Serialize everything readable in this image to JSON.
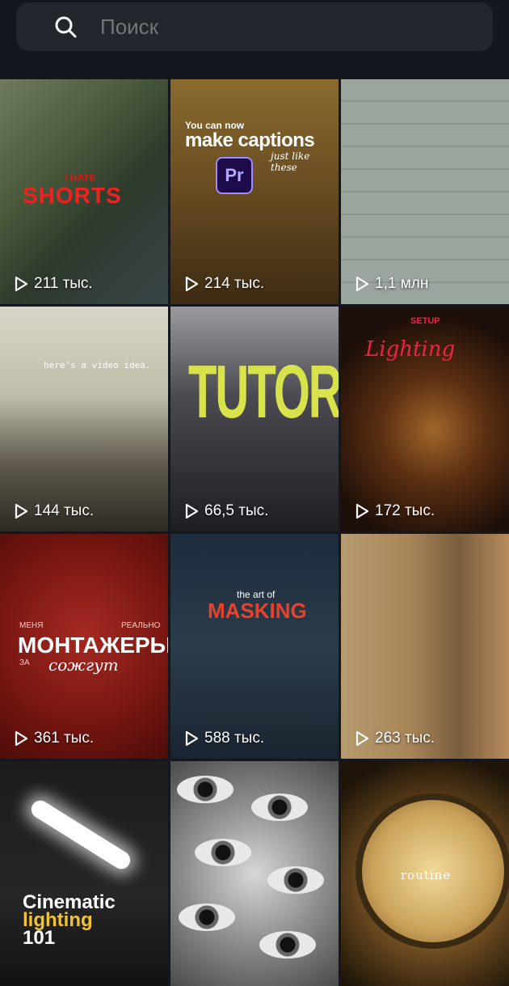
{
  "search": {
    "placeholder": "Поиск"
  },
  "grid": {
    "tiles": [
      {
        "views": "211 тыс.",
        "caption_a": "I HATE",
        "caption_b": "SHORTS"
      },
      {
        "views": "214 тыс.",
        "caption_a": "You can now",
        "caption_b": "make captions",
        "caption_c": "just like these",
        "badge": "Pr"
      },
      {
        "views": "1,1 млн"
      },
      {
        "views": "144 тыс.",
        "caption_a": "here's a video idea."
      },
      {
        "views": "66,5 тыс.",
        "caption_a": "TUTORIAL"
      },
      {
        "views": "172 тыс.",
        "caption_a": "SETUP",
        "caption_b": "Lighting"
      },
      {
        "views": "361 тыс.",
        "caption_a": "МЕНЯ",
        "caption_b": "МОНТАЖЕРЫ",
        "caption_c": "сожгут",
        "caption_d": "РЕАЛЬНО",
        "caption_e": "ЗА"
      },
      {
        "views": "588 тыс.",
        "caption_a": "the art of",
        "caption_b": "MASKING"
      },
      {
        "views": "263 тыс."
      },
      {
        "views": "",
        "caption_a": "Cinematic",
        "caption_b": "lighting",
        "caption_c": "101"
      },
      {
        "views": ""
      },
      {
        "views": "",
        "caption_a": "routine"
      }
    ]
  },
  "colors": {
    "background": "#14181e",
    "search_bg": "#22272e",
    "placeholder": "#9aa0a8"
  },
  "icons": {
    "search": "search-icon",
    "play": "play-icon"
  }
}
